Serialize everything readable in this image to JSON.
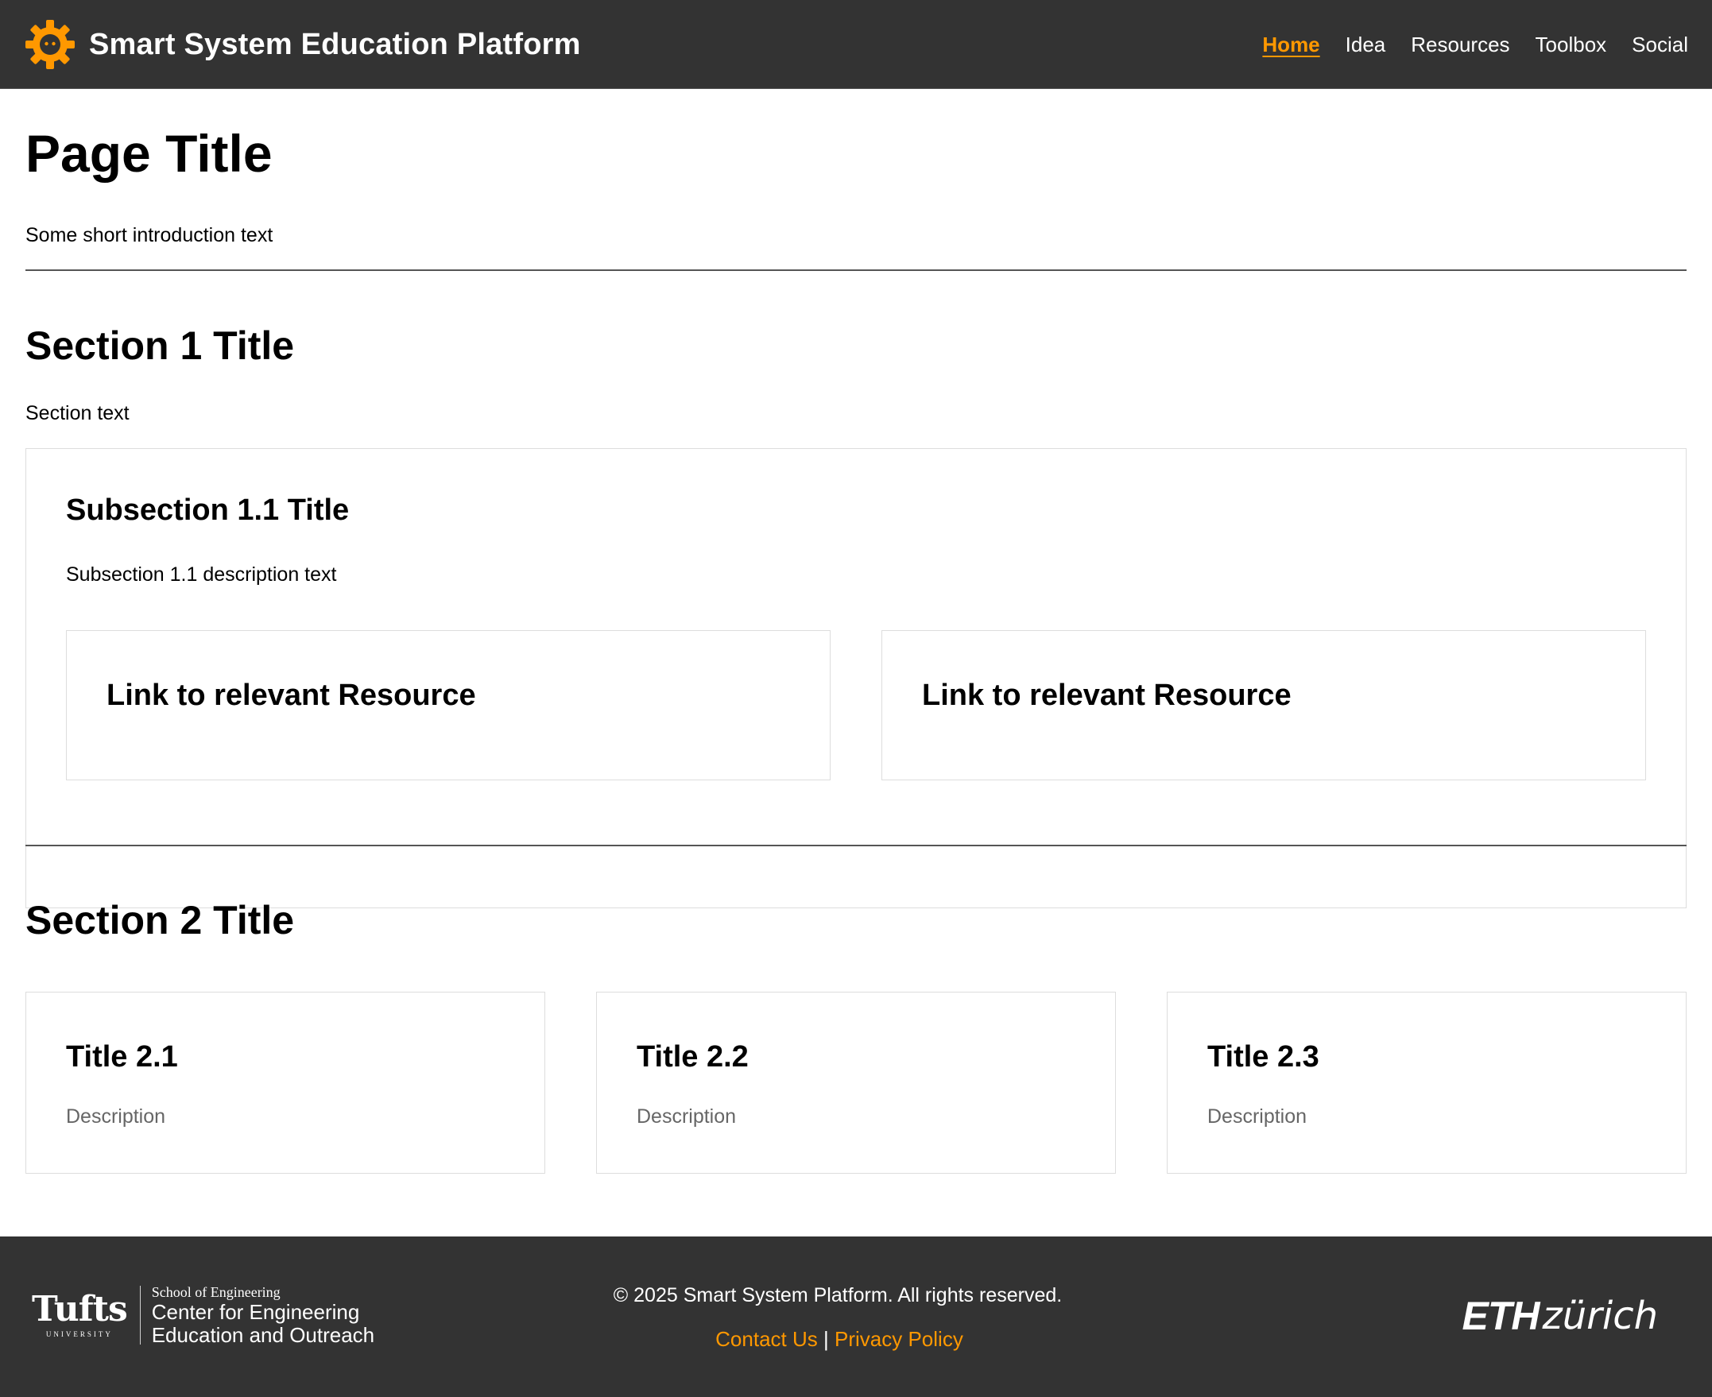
{
  "header": {
    "site_title": "Smart System Education Platform",
    "logo_icon": "gear-robot-icon",
    "nav": [
      {
        "label": "Home",
        "active": true
      },
      {
        "label": "Idea",
        "active": false
      },
      {
        "label": "Resources",
        "active": false
      },
      {
        "label": "Toolbox",
        "active": false
      },
      {
        "label": "Social",
        "active": false
      }
    ]
  },
  "main": {
    "page_title": "Page Title",
    "intro": "Some short introduction text",
    "section1": {
      "title": "Section 1 Title",
      "text": "Section text",
      "subsection": {
        "title": "Subsection 1.1 Title",
        "description": "Subsection 1.1 description text",
        "links": [
          {
            "label": "Link to relevant Resource"
          },
          {
            "label": "Link to relevant Resource"
          }
        ]
      }
    },
    "section2": {
      "title": "Section 2 Title",
      "cards": [
        {
          "title": "Title 2.1",
          "description": "Description"
        },
        {
          "title": "Title 2.2",
          "description": "Description"
        },
        {
          "title": "Title 2.3",
          "description": "Description"
        }
      ]
    }
  },
  "footer": {
    "tufts_logo": {
      "wordmark": "Tufts",
      "university": "UNIVERSITY",
      "school": "School of Engineering",
      "center_line1": "Center for Engineering",
      "center_line2": "Education and Outreach"
    },
    "copyright": "© 2025 Smart System Platform. All rights reserved.",
    "contact_label": "Contact Us",
    "separator": "|",
    "privacy_label": "Privacy Policy",
    "eth_logo": {
      "bold": "ETH",
      "light": "zürich"
    }
  },
  "colors": {
    "header_bg": "#333333",
    "accent": "#ff9800",
    "text": "#000000",
    "muted_text": "#666666",
    "card_border": "#dddddd"
  }
}
